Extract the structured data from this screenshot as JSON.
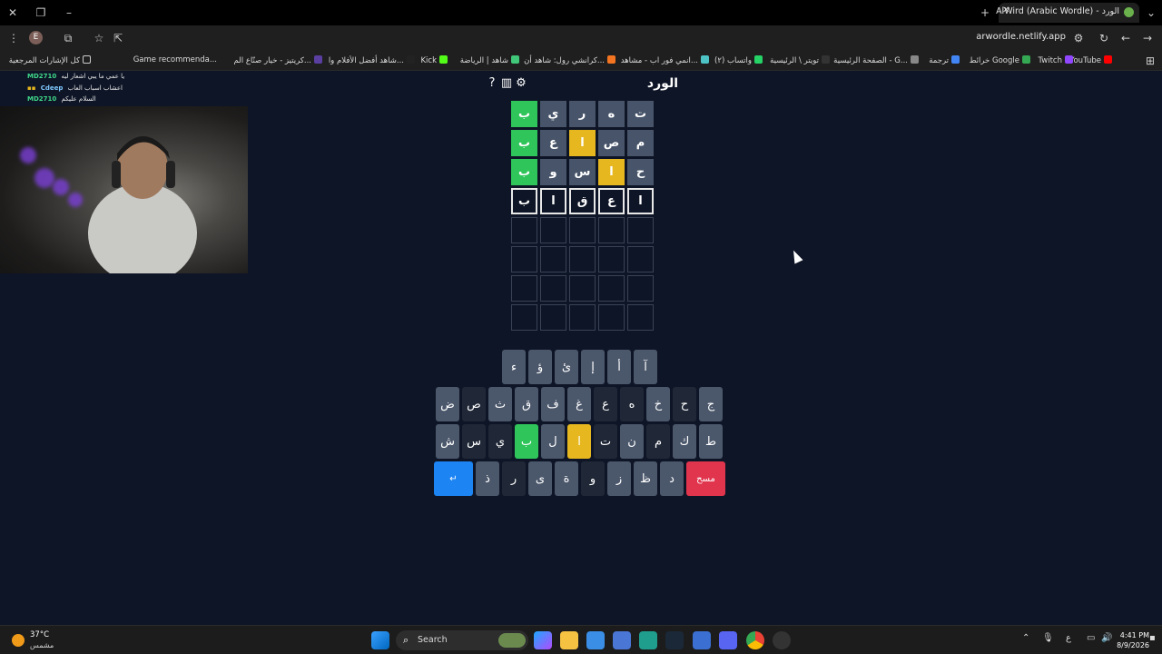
{
  "browser": {
    "tab_title": "AlWird (Arabic Wordle) - الورد",
    "url": "arwordle.netlify.app",
    "profile_initial": "E",
    "bookmarks": [
      "YouTube",
      "Twitch",
      "خرائط Google",
      "ترجمة",
      "الصفحة الرئيسية - G...",
      "تويتر \\ الرئيسية",
      "(٢) واتساب",
      "انمي فور اب - مشاهد...",
      "كرانشي رول: شاهد أن...",
      "شاهد | الرياضة",
      "Kick",
      "شاهد أفضل الأفلام وا...",
      "كريتيز - خيار صنّاع الم...",
      "Game recommenda...",
      "كل الإشارات المرجعية"
    ]
  },
  "chat": [
    {
      "user": "MD2710",
      "message": "يا عمي ما يبي اشعار ليه",
      "color": "#3fd98a"
    },
    {
      "user": "Cdeep",
      "message": "اعشاب اسباب العاب",
      "color": "#7ec8ff"
    },
    {
      "user": "MD2710",
      "message": "السلام عليكم",
      "color": "#3fd98a"
    }
  ],
  "game": {
    "title": "الورد",
    "board": [
      [
        {
          "l": "ت",
          "s": "absent"
        },
        {
          "l": "ه",
          "s": "absent"
        },
        {
          "l": "ر",
          "s": "absent"
        },
        {
          "l": "ي",
          "s": "absent"
        },
        {
          "l": "ب",
          "s": "correct"
        }
      ],
      [
        {
          "l": "م",
          "s": "absent"
        },
        {
          "l": "ص",
          "s": "absent"
        },
        {
          "l": "ا",
          "s": "present"
        },
        {
          "l": "ع",
          "s": "absent"
        },
        {
          "l": "ب",
          "s": "correct"
        }
      ],
      [
        {
          "l": "ح",
          "s": "absent"
        },
        {
          "l": "ا",
          "s": "present"
        },
        {
          "l": "س",
          "s": "absent"
        },
        {
          "l": "و",
          "s": "absent"
        },
        {
          "l": "ب",
          "s": "correct"
        }
      ],
      [
        {
          "l": "ا",
          "s": "typed"
        },
        {
          "l": "ع",
          "s": "typed"
        },
        {
          "l": "ق",
          "s": "typed"
        },
        {
          "l": "ا",
          "s": "typed"
        },
        {
          "l": "ب",
          "s": "typed"
        }
      ],
      [
        {
          "l": "",
          "s": "empty"
        },
        {
          "l": "",
          "s": "empty"
        },
        {
          "l": "",
          "s": "empty"
        },
        {
          "l": "",
          "s": "empty"
        },
        {
          "l": "",
          "s": "empty"
        }
      ],
      [
        {
          "l": "",
          "s": "empty"
        },
        {
          "l": "",
          "s": "empty"
        },
        {
          "l": "",
          "s": "empty"
        },
        {
          "l": "",
          "s": "empty"
        },
        {
          "l": "",
          "s": "empty"
        }
      ],
      [
        {
          "l": "",
          "s": "empty"
        },
        {
          "l": "",
          "s": "empty"
        },
        {
          "l": "",
          "s": "empty"
        },
        {
          "l": "",
          "s": "empty"
        },
        {
          "l": "",
          "s": "empty"
        }
      ],
      [
        {
          "l": "",
          "s": "empty"
        },
        {
          "l": "",
          "s": "empty"
        },
        {
          "l": "",
          "s": "empty"
        },
        {
          "l": "",
          "s": "empty"
        },
        {
          "l": "",
          "s": "empty"
        }
      ]
    ],
    "keyboard": [
      [
        {
          "k": "آ"
        },
        {
          "k": "أ"
        },
        {
          "k": "إ"
        },
        {
          "k": "ئ"
        },
        {
          "k": "ؤ"
        },
        {
          "k": "ء"
        }
      ],
      [
        {
          "k": "ج"
        },
        {
          "k": "ح",
          "s": "absent"
        },
        {
          "k": "خ"
        },
        {
          "k": "ه",
          "s": "absent"
        },
        {
          "k": "ع",
          "s": "absent"
        },
        {
          "k": "غ"
        },
        {
          "k": "ف"
        },
        {
          "k": "ق"
        },
        {
          "k": "ث"
        },
        {
          "k": "ص",
          "s": "absent"
        },
        {
          "k": "ض"
        }
      ],
      [
        {
          "k": "ط"
        },
        {
          "k": "ك"
        },
        {
          "k": "م",
          "s": "absent"
        },
        {
          "k": "ن"
        },
        {
          "k": "ت",
          "s": "absent"
        },
        {
          "k": "ا",
          "s": "present"
        },
        {
          "k": "ل"
        },
        {
          "k": "ب",
          "s": "correct"
        },
        {
          "k": "ي",
          "s": "absent"
        },
        {
          "k": "س",
          "s": "absent"
        },
        {
          "k": "ش"
        }
      ],
      [
        {
          "k": "مسح",
          "s": "delete"
        },
        {
          "k": "د"
        },
        {
          "k": "ظ"
        },
        {
          "k": "ز"
        },
        {
          "k": "و",
          "s": "absent"
        },
        {
          "k": "ة"
        },
        {
          "k": "ى"
        },
        {
          "k": "ر",
          "s": "absent"
        },
        {
          "k": "ذ"
        },
        {
          "k": "↵",
          "s": "enter"
        }
      ]
    ]
  },
  "taskbar": {
    "temperature": "37°C",
    "weather": "مشمس",
    "search_label": "Search",
    "input_lang": "ع",
    "time": "4:41 PM",
    "date": "8/9/2026"
  },
  "colors": {
    "correct": "#2fc55a",
    "present": "#e6b71e",
    "absent": "#202837",
    "background": "#0e1526"
  }
}
